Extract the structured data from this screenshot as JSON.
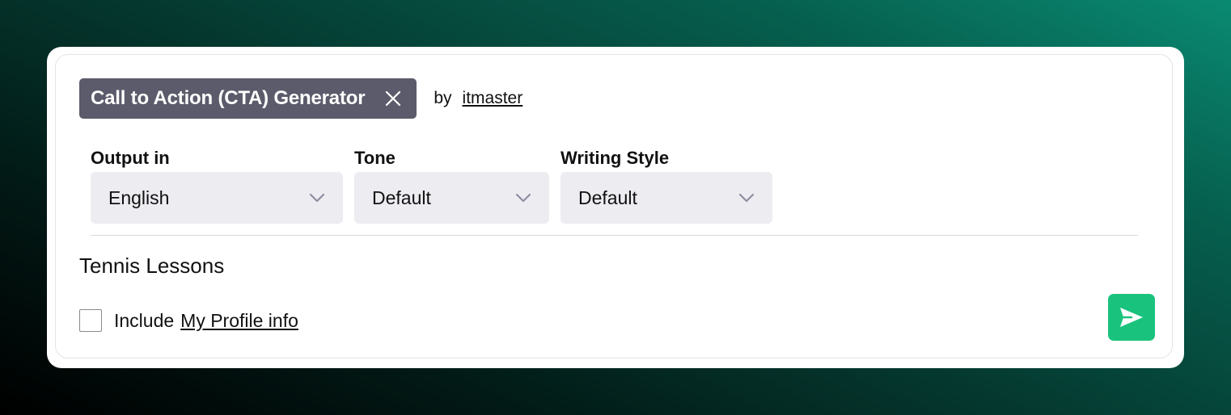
{
  "template": {
    "title": "Call to Action (CTA) Generator",
    "by_label": "by",
    "author": "itmaster"
  },
  "fields": {
    "output": {
      "label": "Output in",
      "value": "English"
    },
    "tone": {
      "label": "Tone",
      "value": "Default"
    },
    "style": {
      "label": "Writing Style",
      "value": "Default"
    }
  },
  "prompt": {
    "value": "Tennis Lessons"
  },
  "profile": {
    "include_label": "Include",
    "link_label": "My Profile info",
    "checked": false
  },
  "colors": {
    "chip_bg": "#5b5b6b",
    "select_bg": "#ececf1",
    "send_bg": "#19c37d"
  },
  "icons": {
    "chip_close": "close-icon",
    "select_chevron": "chevron-down-icon",
    "send": "send-icon"
  }
}
